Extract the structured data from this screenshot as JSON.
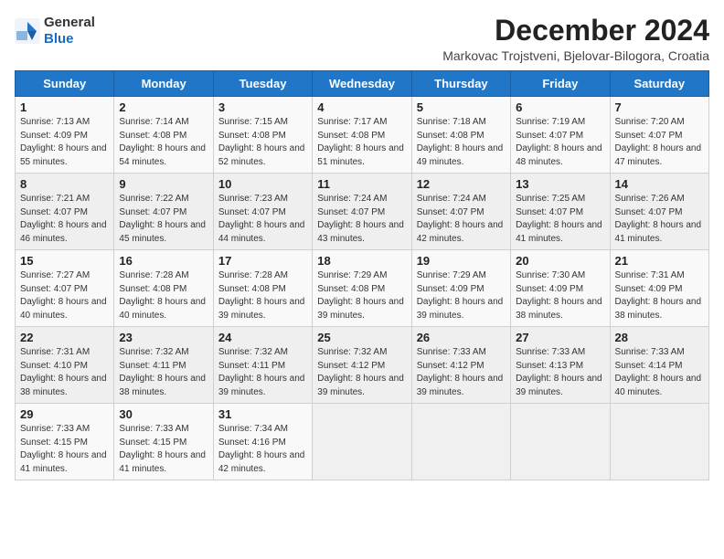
{
  "logo": {
    "general": "General",
    "blue": "Blue"
  },
  "title": "December 2024",
  "location": "Markovac Trojstveni, Bjelovar-Bilogora, Croatia",
  "days_of_week": [
    "Sunday",
    "Monday",
    "Tuesday",
    "Wednesday",
    "Thursday",
    "Friday",
    "Saturday"
  ],
  "weeks": [
    [
      {
        "day": "1",
        "sunrise": "Sunrise: 7:13 AM",
        "sunset": "Sunset: 4:09 PM",
        "daylight": "Daylight: 8 hours and 55 minutes."
      },
      {
        "day": "2",
        "sunrise": "Sunrise: 7:14 AM",
        "sunset": "Sunset: 4:08 PM",
        "daylight": "Daylight: 8 hours and 54 minutes."
      },
      {
        "day": "3",
        "sunrise": "Sunrise: 7:15 AM",
        "sunset": "Sunset: 4:08 PM",
        "daylight": "Daylight: 8 hours and 52 minutes."
      },
      {
        "day": "4",
        "sunrise": "Sunrise: 7:17 AM",
        "sunset": "Sunset: 4:08 PM",
        "daylight": "Daylight: 8 hours and 51 minutes."
      },
      {
        "day": "5",
        "sunrise": "Sunrise: 7:18 AM",
        "sunset": "Sunset: 4:08 PM",
        "daylight": "Daylight: 8 hours and 49 minutes."
      },
      {
        "day": "6",
        "sunrise": "Sunrise: 7:19 AM",
        "sunset": "Sunset: 4:07 PM",
        "daylight": "Daylight: 8 hours and 48 minutes."
      },
      {
        "day": "7",
        "sunrise": "Sunrise: 7:20 AM",
        "sunset": "Sunset: 4:07 PM",
        "daylight": "Daylight: 8 hours and 47 minutes."
      }
    ],
    [
      {
        "day": "8",
        "sunrise": "Sunrise: 7:21 AM",
        "sunset": "Sunset: 4:07 PM",
        "daylight": "Daylight: 8 hours and 46 minutes."
      },
      {
        "day": "9",
        "sunrise": "Sunrise: 7:22 AM",
        "sunset": "Sunset: 4:07 PM",
        "daylight": "Daylight: 8 hours and 45 minutes."
      },
      {
        "day": "10",
        "sunrise": "Sunrise: 7:23 AM",
        "sunset": "Sunset: 4:07 PM",
        "daylight": "Daylight: 8 hours and 44 minutes."
      },
      {
        "day": "11",
        "sunrise": "Sunrise: 7:24 AM",
        "sunset": "Sunset: 4:07 PM",
        "daylight": "Daylight: 8 hours and 43 minutes."
      },
      {
        "day": "12",
        "sunrise": "Sunrise: 7:24 AM",
        "sunset": "Sunset: 4:07 PM",
        "daylight": "Daylight: 8 hours and 42 minutes."
      },
      {
        "day": "13",
        "sunrise": "Sunrise: 7:25 AM",
        "sunset": "Sunset: 4:07 PM",
        "daylight": "Daylight: 8 hours and 41 minutes."
      },
      {
        "day": "14",
        "sunrise": "Sunrise: 7:26 AM",
        "sunset": "Sunset: 4:07 PM",
        "daylight": "Daylight: 8 hours and 41 minutes."
      }
    ],
    [
      {
        "day": "15",
        "sunrise": "Sunrise: 7:27 AM",
        "sunset": "Sunset: 4:07 PM",
        "daylight": "Daylight: 8 hours and 40 minutes."
      },
      {
        "day": "16",
        "sunrise": "Sunrise: 7:28 AM",
        "sunset": "Sunset: 4:08 PM",
        "daylight": "Daylight: 8 hours and 40 minutes."
      },
      {
        "day": "17",
        "sunrise": "Sunrise: 7:28 AM",
        "sunset": "Sunset: 4:08 PM",
        "daylight": "Daylight: 8 hours and 39 minutes."
      },
      {
        "day": "18",
        "sunrise": "Sunrise: 7:29 AM",
        "sunset": "Sunset: 4:08 PM",
        "daylight": "Daylight: 8 hours and 39 minutes."
      },
      {
        "day": "19",
        "sunrise": "Sunrise: 7:29 AM",
        "sunset": "Sunset: 4:09 PM",
        "daylight": "Daylight: 8 hours and 39 minutes."
      },
      {
        "day": "20",
        "sunrise": "Sunrise: 7:30 AM",
        "sunset": "Sunset: 4:09 PM",
        "daylight": "Daylight: 8 hours and 38 minutes."
      },
      {
        "day": "21",
        "sunrise": "Sunrise: 7:31 AM",
        "sunset": "Sunset: 4:09 PM",
        "daylight": "Daylight: 8 hours and 38 minutes."
      }
    ],
    [
      {
        "day": "22",
        "sunrise": "Sunrise: 7:31 AM",
        "sunset": "Sunset: 4:10 PM",
        "daylight": "Daylight: 8 hours and 38 minutes."
      },
      {
        "day": "23",
        "sunrise": "Sunrise: 7:32 AM",
        "sunset": "Sunset: 4:11 PM",
        "daylight": "Daylight: 8 hours and 38 minutes."
      },
      {
        "day": "24",
        "sunrise": "Sunrise: 7:32 AM",
        "sunset": "Sunset: 4:11 PM",
        "daylight": "Daylight: 8 hours and 39 minutes."
      },
      {
        "day": "25",
        "sunrise": "Sunrise: 7:32 AM",
        "sunset": "Sunset: 4:12 PM",
        "daylight": "Daylight: 8 hours and 39 minutes."
      },
      {
        "day": "26",
        "sunrise": "Sunrise: 7:33 AM",
        "sunset": "Sunset: 4:12 PM",
        "daylight": "Daylight: 8 hours and 39 minutes."
      },
      {
        "day": "27",
        "sunrise": "Sunrise: 7:33 AM",
        "sunset": "Sunset: 4:13 PM",
        "daylight": "Daylight: 8 hours and 39 minutes."
      },
      {
        "day": "28",
        "sunrise": "Sunrise: 7:33 AM",
        "sunset": "Sunset: 4:14 PM",
        "daylight": "Daylight: 8 hours and 40 minutes."
      }
    ],
    [
      {
        "day": "29",
        "sunrise": "Sunrise: 7:33 AM",
        "sunset": "Sunset: 4:15 PM",
        "daylight": "Daylight: 8 hours and 41 minutes."
      },
      {
        "day": "30",
        "sunrise": "Sunrise: 7:33 AM",
        "sunset": "Sunset: 4:15 PM",
        "daylight": "Daylight: 8 hours and 41 minutes."
      },
      {
        "day": "31",
        "sunrise": "Sunrise: 7:34 AM",
        "sunset": "Sunset: 4:16 PM",
        "daylight": "Daylight: 8 hours and 42 minutes."
      },
      null,
      null,
      null,
      null
    ]
  ]
}
